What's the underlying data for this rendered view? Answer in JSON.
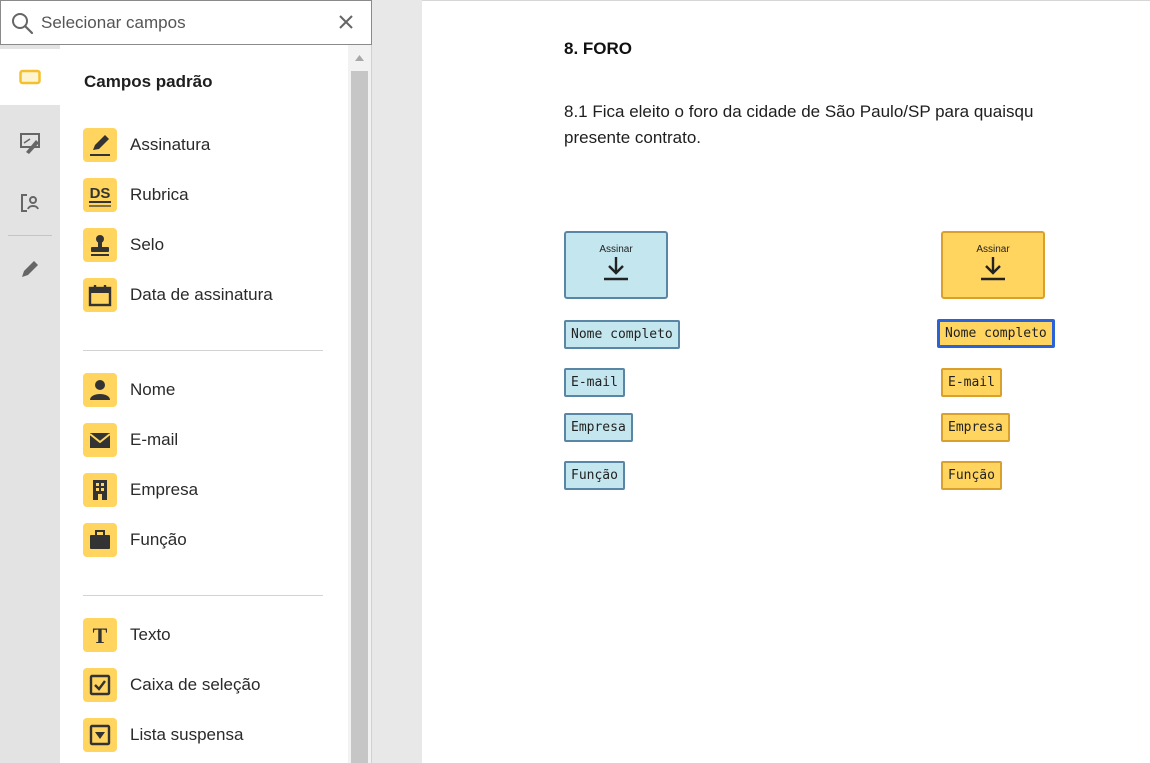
{
  "search": {
    "placeholder": "Selecionar campos"
  },
  "panel": {
    "heading": "Campos padrão",
    "signature_fields": [
      {
        "label": "Assinatura",
        "icon": "pen-icon"
      },
      {
        "label": "Rubrica",
        "icon": "ds-initials-icon"
      },
      {
        "label": "Selo",
        "icon": "stamp-icon"
      },
      {
        "label": "Data de assinatura",
        "icon": "calendar-icon"
      }
    ],
    "info_fields": [
      {
        "label": "Nome",
        "icon": "person-icon"
      },
      {
        "label": "E-mail",
        "icon": "envelope-icon"
      },
      {
        "label": "Empresa",
        "icon": "building-icon"
      },
      {
        "label": "Função",
        "icon": "briefcase-icon"
      }
    ],
    "input_fields": [
      {
        "label": "Texto",
        "icon": "text-t-icon"
      },
      {
        "label": "Caixa de seleção",
        "icon": "checkbox-icon"
      },
      {
        "label": "Lista suspensa",
        "icon": "dropdown-icon"
      }
    ]
  },
  "document": {
    "heading": "8. FORO",
    "paragraph_line1": "8.1 Fica eleito o foro da cidade de São Paulo/SP para quaisqu",
    "paragraph_line2": "presente contrato.",
    "recipient_blue": {
      "sign_label": "Assinar",
      "fields": [
        "Nome completo",
        "E-mail",
        "Empresa",
        "Função"
      ]
    },
    "recipient_yellow": {
      "sign_label": "Assinar",
      "fields": [
        "Nome completo",
        "E-mail",
        "Empresa",
        "Função"
      ]
    }
  },
  "colors": {
    "field_icon_bg": "#ffd45f",
    "recipient_blue_bg": "#c4e6ee",
    "recipient_blue_border": "#5a86a6",
    "recipient_yellow_bg": "#ffd45f",
    "recipient_yellow_border": "#d9a02d",
    "selection_border": "#2a62d8"
  }
}
